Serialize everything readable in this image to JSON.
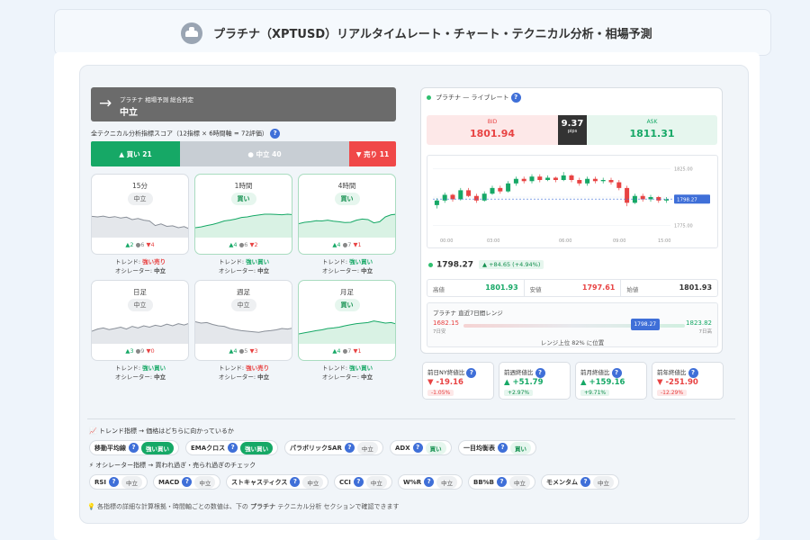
{
  "header": {
    "title": "プラチナ（XPTUSD）リアルタイムレート・チャート・テクニカル分析・相場予測"
  },
  "verdict": {
    "label": "プラチナ 相場予測 総合判定",
    "value": "中立",
    "arrow": "→"
  },
  "score": {
    "label": "全テクニカル分析指標スコア（12指標 × 6時間軸 = 72評価）",
    "help": "?",
    "buy": "▲ 買い 21",
    "neutral": "● 中立 40",
    "sell": "▼ 売り 11"
  },
  "timeframes": [
    {
      "name": "15分",
      "signal": "中立",
      "buy": "▲2",
      "neu": "●6",
      "sell": "▼4",
      "trend_label": "トレンド:",
      "trend": "強い売り",
      "osc_label": "オシレーター:",
      "osc": "中立",
      "series": [
        0.72,
        0.7,
        0.73,
        0.68,
        0.71,
        0.66,
        0.69,
        0.6,
        0.64,
        0.58,
        0.55,
        0.38,
        0.44,
        0.35,
        0.37,
        0.3,
        0.34,
        0.25
      ]
    },
    {
      "name": "1時間",
      "signal": "買い",
      "buy": "▲4",
      "neu": "●6",
      "sell": "▼2",
      "trend_label": "トレンド:",
      "trend": "強い買い",
      "osc_label": "オシレーター:",
      "osc": "中立",
      "series": [
        0.3,
        0.33,
        0.38,
        0.42,
        0.48,
        0.55,
        0.58,
        0.62,
        0.68,
        0.7,
        0.74,
        0.77,
        0.8,
        0.8,
        0.79,
        0.78,
        0.8,
        0.78
      ]
    },
    {
      "name": "4時間",
      "signal": "買い",
      "buy": "▲4",
      "neu": "●7",
      "sell": "▼1",
      "trend_label": "トレンド:",
      "trend": "強い買い",
      "osc_label": "オシレーター:",
      "osc": "中立",
      "series": [
        0.45,
        0.5,
        0.52,
        0.56,
        0.55,
        0.58,
        0.54,
        0.52,
        0.49,
        0.5,
        0.58,
        0.62,
        0.6,
        0.48,
        0.52,
        0.7,
        0.78,
        0.8
      ]
    },
    {
      "name": "日足",
      "signal": "中立",
      "buy": "▲3",
      "neu": "●9",
      "sell": "▼0",
      "trend_label": "トレンド:",
      "trend": "強い買い",
      "osc_label": "オシレーター:",
      "osc": "中立",
      "series": [
        0.4,
        0.48,
        0.52,
        0.46,
        0.5,
        0.55,
        0.48,
        0.58,
        0.52,
        0.6,
        0.55,
        0.62,
        0.58,
        0.66,
        0.6,
        0.68,
        0.63,
        0.7
      ]
    },
    {
      "name": "週足",
      "signal": "中立",
      "buy": "▲4",
      "neu": "●5",
      "sell": "▼3",
      "trend_label": "トレンド:",
      "trend": "強い売り",
      "osc_label": "オシレーター:",
      "osc": "中立",
      "series": [
        0.75,
        0.7,
        0.72,
        0.65,
        0.6,
        0.58,
        0.5,
        0.46,
        0.42,
        0.4,
        0.38,
        0.36,
        0.4,
        0.42,
        0.45,
        0.5,
        0.48,
        0.52
      ]
    },
    {
      "name": "月足",
      "signal": "買い",
      "buy": "▲4",
      "neu": "●7",
      "sell": "▼1",
      "trend_label": "トレンド:",
      "trend": "強い買い",
      "osc_label": "オシレーター:",
      "osc": "中立",
      "series": [
        0.3,
        0.34,
        0.38,
        0.42,
        0.45,
        0.5,
        0.52,
        0.55,
        0.6,
        0.64,
        0.68,
        0.7,
        0.72,
        0.78,
        0.74,
        0.7,
        0.72,
        0.66
      ]
    }
  ],
  "live": {
    "title": "プラチナ — ライブレート",
    "help": "?",
    "bid_label": "BID",
    "bid": "1801.94",
    "spread": "9.37",
    "spread_unit": "pips",
    "ask_label": "ASK",
    "ask": "1811.31",
    "price": "1798.27",
    "change": "▲ +84.65 (+4.94%)",
    "high_label": "高値",
    "high": "1801.93",
    "low_label": "安値",
    "low": "1797.61",
    "open_label": "始値",
    "open": "1801.93"
  },
  "chart_data": {
    "type": "candlestick",
    "x_ticks": [
      "00:00",
      "03:00",
      "06:00",
      "09:00",
      "15:00"
    ],
    "y_ticks": [
      "1825.00",
      "1800.00",
      "1775.00"
    ],
    "ylim": [
      1770,
      1830
    ],
    "current": "1798.27",
    "candles": [
      [
        1793,
        1797,
        1790,
        1799
      ],
      [
        1797,
        1802,
        1795,
        1804
      ],
      [
        1802,
        1798,
        1796,
        1803
      ],
      [
        1798,
        1806,
        1797,
        1808
      ],
      [
        1806,
        1801,
        1800,
        1808
      ],
      [
        1801,
        1797,
        1795,
        1803
      ],
      [
        1797,
        1803,
        1796,
        1805
      ],
      [
        1803,
        1808,
        1802,
        1810
      ],
      [
        1808,
        1805,
        1803,
        1810
      ],
      [
        1805,
        1812,
        1804,
        1814
      ],
      [
        1812,
        1816,
        1810,
        1818
      ],
      [
        1816,
        1814,
        1812,
        1818
      ],
      [
        1814,
        1818,
        1812,
        1820
      ],
      [
        1818,
        1815,
        1813,
        1820
      ],
      [
        1815,
        1817,
        1814,
        1819
      ],
      [
        1817,
        1815,
        1813,
        1818
      ],
      [
        1815,
        1819,
        1814,
        1822
      ],
      [
        1819,
        1815,
        1813,
        1820
      ],
      [
        1815,
        1812,
        1810,
        1817
      ],
      [
        1812,
        1816,
        1810,
        1818
      ],
      [
        1816,
        1814,
        1812,
        1818
      ],
      [
        1814,
        1815,
        1812,
        1817
      ],
      [
        1815,
        1813,
        1811,
        1817
      ],
      [
        1813,
        1808,
        1806,
        1815
      ],
      [
        1808,
        1795,
        1792,
        1810
      ],
      [
        1795,
        1801,
        1794,
        1803
      ],
      [
        1801,
        1798,
        1796,
        1803
      ],
      [
        1798,
        1800,
        1796,
        1802
      ],
      [
        1800,
        1797,
        1795,
        1801
      ],
      [
        1797,
        1798,
        1795,
        1800
      ]
    ]
  },
  "range": {
    "title": "プラチナ 直近7日間レンジ",
    "low": "1682.15",
    "low_sub": "7日安",
    "high": "1823.82",
    "high_sub": "7日高",
    "current": "1798.27",
    "position": 0.82,
    "pos_text": "レンジ上位 82% に位置"
  },
  "compare": [
    {
      "label": "前日NY終値比",
      "value": "▼ -19.16",
      "pct": "-1.05%",
      "dir": "dn"
    },
    {
      "label": "前週終値比",
      "value": "▲ +51.79",
      "pct": "+2.97%",
      "dir": "up"
    },
    {
      "label": "前月終値比",
      "value": "▲ +159.16",
      "pct": "+9.71%",
      "dir": "up"
    },
    {
      "label": "前年終値比",
      "value": "▼ -251.90",
      "pct": "-12.29%",
      "dir": "dn"
    }
  ],
  "trend_section": {
    "title": "トレンド指標 → 価格はどちらに向かっているか",
    "icon": "📈",
    "items": [
      {
        "name": "移動平均線",
        "signal": "強い買い",
        "cls": "sb"
      },
      {
        "name": "EMAクロス",
        "signal": "強い買い",
        "cls": "sb"
      },
      {
        "name": "パラボリックSAR",
        "signal": "中立",
        "cls": "n2"
      },
      {
        "name": "ADX",
        "signal": "買い",
        "cls": "b"
      },
      {
        "name": "一目均衡表",
        "signal": "買い",
        "cls": "b"
      }
    ]
  },
  "osc_section": {
    "title": "オシレーター指標 → 買われ過ぎ・売られ過ぎのチェック",
    "icon": "⚡",
    "items": [
      {
        "name": "RSI",
        "signal": "中立",
        "cls": "n2"
      },
      {
        "name": "MACD",
        "signal": "中立",
        "cls": "n2"
      },
      {
        "name": "ストキャスティクス",
        "signal": "中立",
        "cls": "n2"
      },
      {
        "name": "CCI",
        "signal": "中立",
        "cls": "n2"
      },
      {
        "name": "W%R",
        "signal": "中立",
        "cls": "n2"
      },
      {
        "name": "BB%B",
        "signal": "中立",
        "cls": "n2"
      },
      {
        "name": "モメンタム",
        "signal": "中立",
        "cls": "n2"
      }
    ]
  },
  "note": {
    "icon": "💡",
    "pre": "各指標の詳細な計算根拠・時間軸ごとの数値は、下の ",
    "bold": "プラチナ",
    "post": " テクニカル分析 セクションで確認できます"
  },
  "colors": {
    "buy": "#16a866",
    "sell": "#f04848",
    "neutral": "#c8ced4",
    "accent": "#3f6fd8"
  }
}
